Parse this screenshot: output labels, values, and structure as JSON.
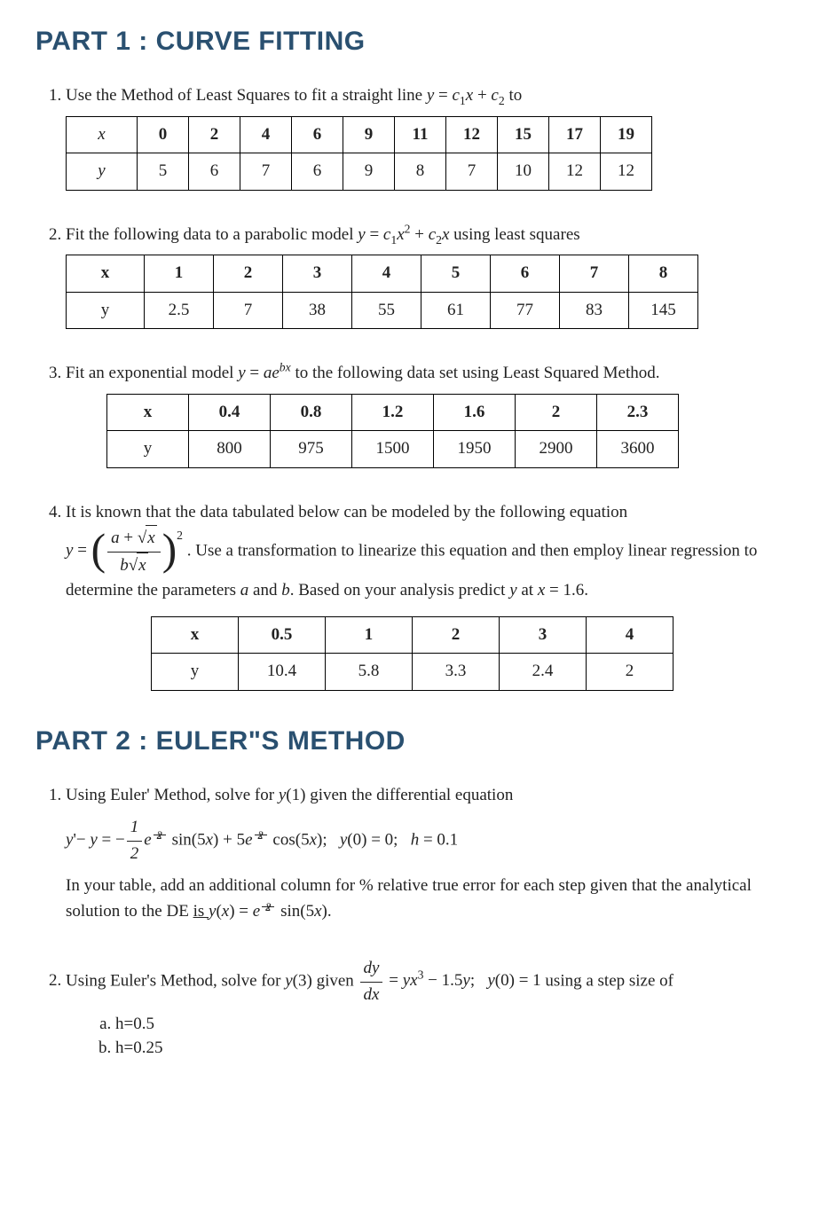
{
  "part1": {
    "title": "PART 1 : CURVE FITTING",
    "q1": {
      "text_a": "Use the Method of Least Squares to fit a straight line ",
      "text_b": " to",
      "eq": "y = c₁x + c₂",
      "table": {
        "row_x_label": "x",
        "row_y_label": "y",
        "x": [
          "0",
          "2",
          "4",
          "6",
          "9",
          "11",
          "12",
          "15",
          "17",
          "19"
        ],
        "y": [
          "5",
          "6",
          "7",
          "6",
          "9",
          "8",
          "7",
          "10",
          "12",
          "12"
        ]
      }
    },
    "q2": {
      "text_a": "Fit the following data to a parabolic model ",
      "text_b": " using least squares",
      "eq": "y = c₁x² + c₂x",
      "table": {
        "row_x_label": "x",
        "row_y_label": "y",
        "x": [
          "1",
          "2",
          "3",
          "4",
          "5",
          "6",
          "7",
          "8"
        ],
        "y": [
          "2.5",
          "7",
          "38",
          "55",
          "61",
          "77",
          "83",
          "145"
        ]
      }
    },
    "q3": {
      "text_a": "Fit an exponential model ",
      "text_b": " to the following data set using Least Squared Method.",
      "eq": "y = ae^{bx}",
      "table": {
        "row_x_label": "x",
        "row_y_label": "y",
        "x": [
          "0.4",
          "0.8",
          "1.2",
          "1.6",
          "2",
          "2.3"
        ],
        "y": [
          "800",
          "975",
          "1500",
          "1950",
          "2900",
          "3600"
        ]
      }
    },
    "q4": {
      "text_a": "It is known that the data tabulated below can be modeled by the following equation",
      "text_b": ". Use a transformation to linearize this equation and then employ linear regression to determine the parameters ",
      "text_c": " and ",
      "text_d": ". Based on your analysis predict ",
      "text_e": " at ",
      "text_f": " = 1.6.",
      "param_a": "a",
      "param_b": "b",
      "var_y": "y",
      "var_x": "x",
      "eq_lhs": "y = ",
      "eq_num": "a + √x",
      "eq_den": "b√x",
      "eq_exp": "2",
      "table": {
        "row_x_label": "x",
        "row_y_label": "y",
        "x": [
          "0.5",
          "1",
          "2",
          "3",
          "4"
        ],
        "y": [
          "10.4",
          "5.8",
          "3.3",
          "2.4",
          "2"
        ]
      }
    }
  },
  "part2": {
    "title": "PART 2 : EULER\"S METHOD",
    "q1": {
      "line1_a": "Using Euler' Method, solve for ",
      "line1_b": " given the differential equation",
      "target": "y(1)",
      "eq_text": "y' − y = −½ e^{x/2} sin(5x) + 5e^{x/2} cos(5x);   y(0) = 0;   h = 0.1",
      "line2_a": "In your table, add an additional column for % relative true error for each step given that the analytical solution to the DE ",
      "line2_is": "is ",
      "analytic": "y(x) = e^{x/2} sin(5x)",
      "period": "."
    },
    "q2": {
      "line_a": "Using Euler's Method, solve for ",
      "line_b": " given ",
      "line_c": " using a step size of",
      "target": "y(3)",
      "ode": "dy/dx = yx³ − 1.5y;   y(0) = 1",
      "opt_a": "h=0.5",
      "opt_b": "h=0.25"
    }
  }
}
